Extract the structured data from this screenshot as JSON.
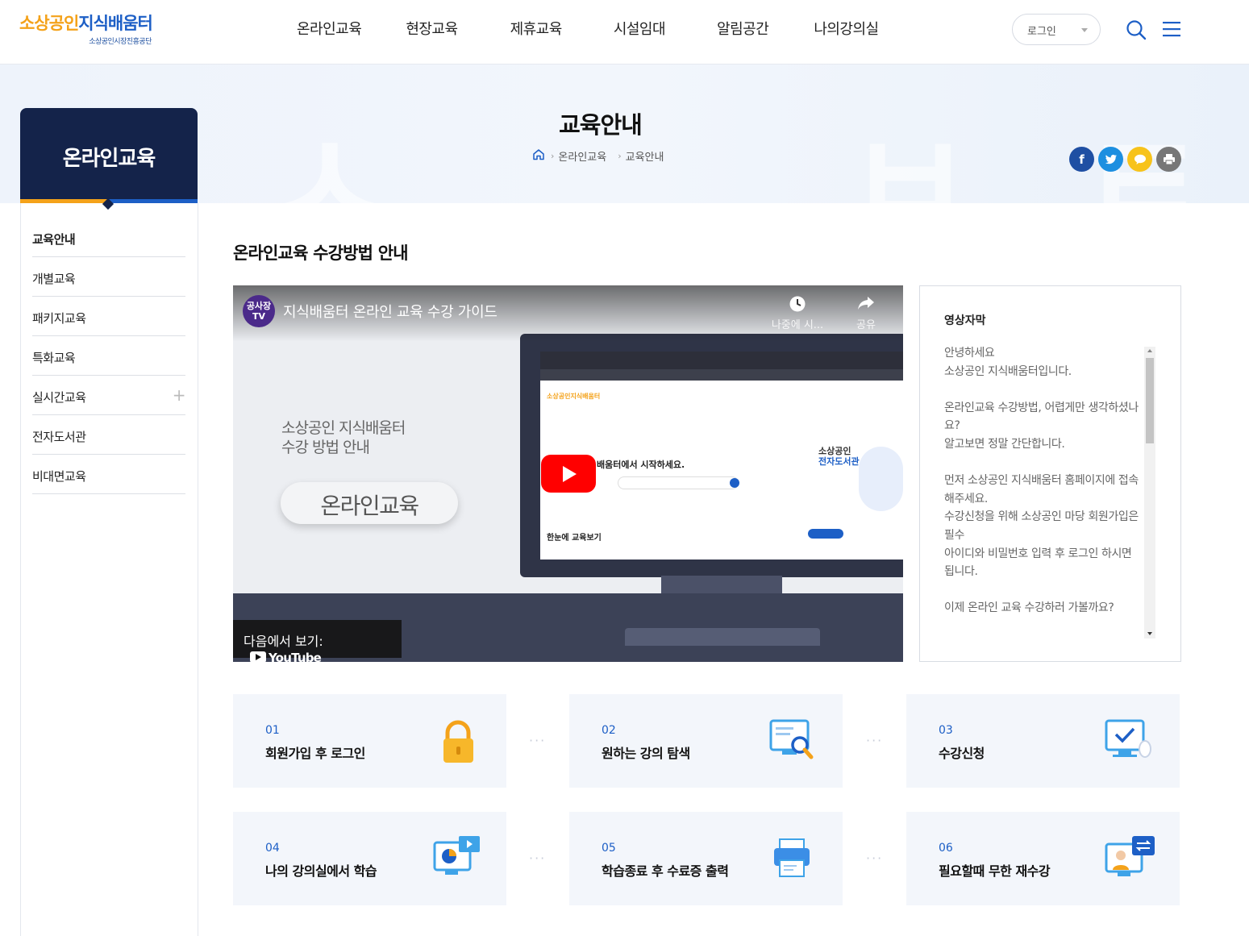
{
  "logo": {
    "main_a": "소상공인",
    "main_b": "지식배움터",
    "sub": "소상공인시장진흥공단"
  },
  "gnb": [
    "온라인교육",
    "현장교육",
    "제휴교육",
    "시설임대",
    "알림공간",
    "나의강의실"
  ],
  "header": {
    "login_label": "로그인"
  },
  "page": {
    "title": "교육안내",
    "breadcrumb": [
      "온라인교육",
      "교육안내"
    ]
  },
  "lnb": {
    "title": "온라인교육",
    "items": [
      {
        "label": "교육안내"
      },
      {
        "label": "개별교육"
      },
      {
        "label": "패키지교육"
      },
      {
        "label": "특화교육"
      },
      {
        "label": "실시간교육",
        "expand": "+"
      },
      {
        "label": "전자도서관"
      },
      {
        "label": "비대면교육"
      }
    ]
  },
  "content": {
    "section_title": "온라인교육 수강방법 안내",
    "video": {
      "channel": "공사장 TV",
      "title": "지식배움터 온라인 교육 수강 가이드",
      "watch_later": "나중에 시...",
      "share": "공유",
      "overlay_line1": "소상공인 지식배움터",
      "overlay_line2": "수강 방법 안내",
      "overlay_pill": "온라인교육",
      "screen_text1": "배움터에서 시작하세요.",
      "screen_text2": "소상공인",
      "screen_text3": "전자도서관",
      "screen_text4": "한눈에 교육보기",
      "watch_on": "다음에서 보기:",
      "youtube": "YouTube"
    },
    "caption": {
      "title": "영상자막",
      "paragraphs": [
        "안녕하세요\n소상공인 지식배움터입니다.",
        "온라인교육 수강방법, 어렵게만 생각하셨나요?\n알고보면 정말 간단합니다.",
        "먼저 소상공인 지식배움터 홈페이지에 접속해주세요.\n수강신청을 위해 소상공인 마당 회원가입은 필수\n아이디와 비밀번호 입력 후 로그인 하시면 됩니다.",
        "이제 온라인 교육 수강하러 가볼까요?"
      ]
    },
    "steps": [
      {
        "num": "01",
        "label": "회원가입 후 로그인",
        "icon": "lock-icon"
      },
      {
        "num": "02",
        "label": "원하는 강의 탐색",
        "icon": "search-document-icon"
      },
      {
        "num": "03",
        "label": "수강신청",
        "icon": "monitor-check-icon"
      },
      {
        "num": "04",
        "label": "나의 강의실에서 학습",
        "icon": "monitor-video-icon"
      },
      {
        "num": "05",
        "label": "학습종료 후 수료증 출력",
        "icon": "printer-icon"
      },
      {
        "num": "06",
        "label": "필요할때 무한 재수강",
        "icon": "repeat-monitor-icon"
      }
    ]
  },
  "colors": {
    "navy": "#14234a",
    "orange": "#f4a21a",
    "blue": "#1d5fc6",
    "facebook": "#1f4fa3",
    "twitter": "#1d8fe0",
    "kakao": "#f7c31b",
    "print": "#777777"
  }
}
